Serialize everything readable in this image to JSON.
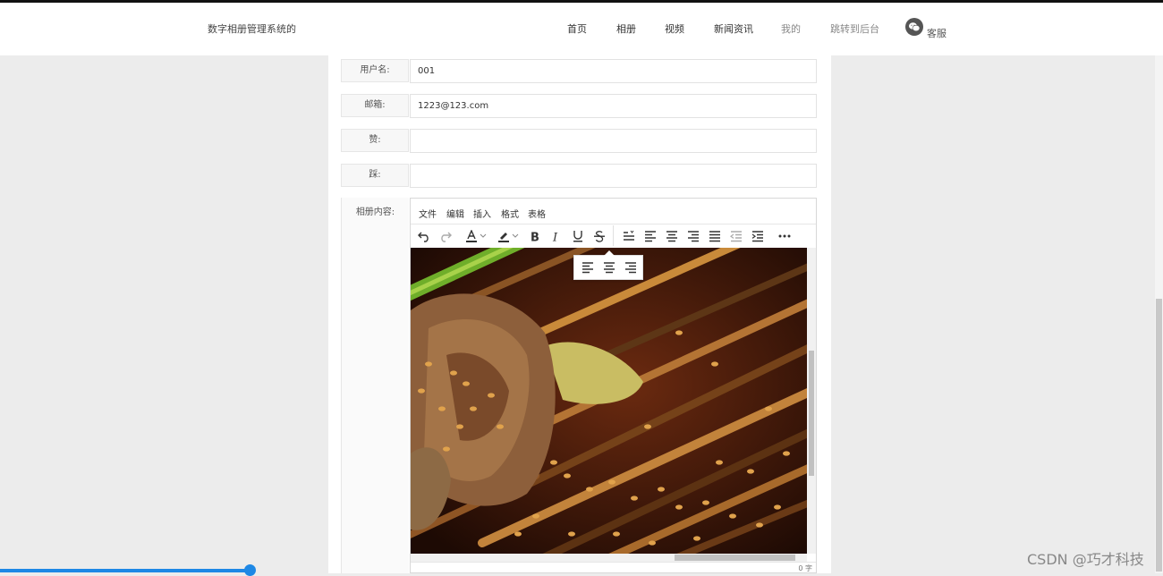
{
  "header": {
    "brand": "数字相册管理系统的",
    "nav": [
      "首页",
      "相册",
      "视频",
      "新闻资讯",
      "我的",
      "跳转到后台"
    ],
    "customer_service": "客服"
  },
  "form": {
    "username_label": "用户名:",
    "username_value": "001",
    "email_label": "邮箱:",
    "email_value": "1223@123.com",
    "like_label": "赞:",
    "like_value": "",
    "dislike_label": "踩:",
    "dislike_value": "",
    "content_label": "相册内容:"
  },
  "editor": {
    "menus": [
      "文件",
      "编辑",
      "插入",
      "格式",
      "表格"
    ],
    "word_count": "0 字"
  },
  "progress": {
    "fraction": 0.215
  },
  "watermark": "CSDN @巧才科技"
}
